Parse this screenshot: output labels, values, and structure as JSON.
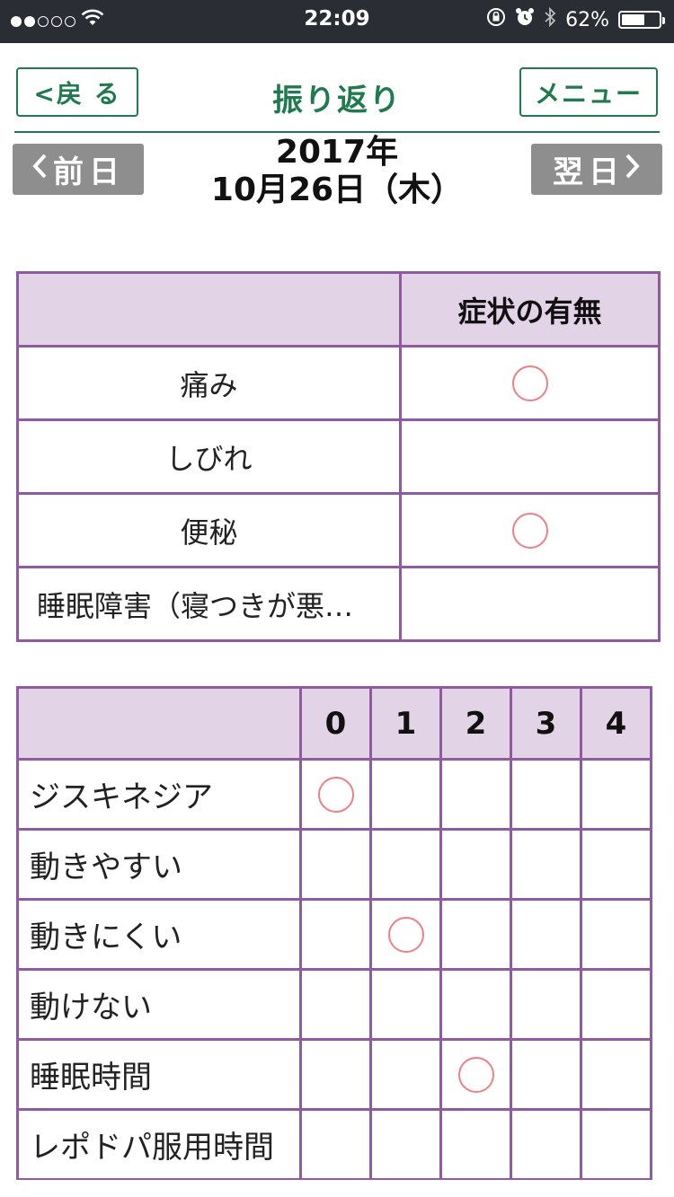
{
  "status_bar": {
    "time": "22:09",
    "battery_text": "62%",
    "battery_level": 0.62,
    "signal_bars": 2,
    "icons": [
      "wifi-icon",
      "rotation-lock-icon",
      "alarm-icon",
      "bluetooth-icon",
      "battery-icon"
    ]
  },
  "header": {
    "back_label": "<戻 る",
    "title": "振り返り",
    "menu_label": "メニュー"
  },
  "date_nav": {
    "prev_label": "前日",
    "next_label": "翌日",
    "year": "2017年",
    "day": "10月26日（木）"
  },
  "colors": {
    "accent_green": "#1f7a4d",
    "table_border": "#8f5aa0",
    "header_fill": "#e3d3e6",
    "mark_red": "#ef7f86",
    "nav_gray": "#8e8e8e"
  },
  "symptoms_table": {
    "column_header": "症状の有無",
    "rows": [
      {
        "label": "痛み",
        "marked": true
      },
      {
        "label": "しびれ",
        "marked": false
      },
      {
        "label": "便秘",
        "marked": true
      },
      {
        "label": "睡眠障害（寝つきが悪…",
        "marked": false
      }
    ]
  },
  "score_table": {
    "columns": [
      "0",
      "1",
      "2",
      "3",
      "4"
    ],
    "rows": [
      {
        "label": "ジスキネジア",
        "marked_index": 0
      },
      {
        "label": "動きやすい",
        "marked_index": null
      },
      {
        "label": "動きにくい",
        "marked_index": 1
      },
      {
        "label": "動けない",
        "marked_index": null
      },
      {
        "label": "睡眠時間",
        "marked_index": 2
      },
      {
        "label": "レポドパ服用時間",
        "marked_index": null
      }
    ]
  }
}
